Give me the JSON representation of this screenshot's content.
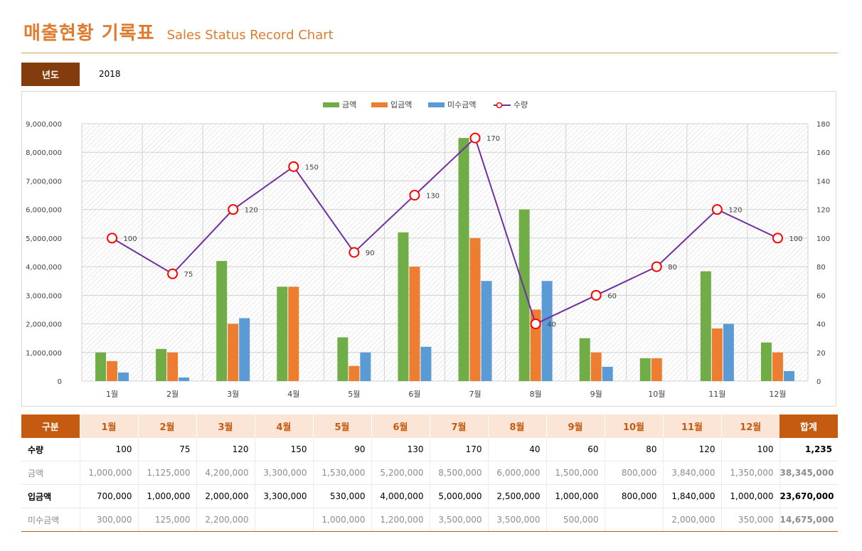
{
  "header": {
    "title": "매출현황 기록표",
    "subtitle": "Sales Status Record Chart"
  },
  "year": {
    "label": "년도",
    "value": "2018"
  },
  "colors": {
    "amount": "#70ad47",
    "received": "#ed7d31",
    "unpaid": "#5b9bd5",
    "quantity_line": "#7030a0",
    "quantity_marker": "#ff0000",
    "accent": "#c55a11"
  },
  "chart_data": {
    "type": "bar",
    "categories": [
      "1월",
      "2월",
      "3월",
      "4월",
      "5월",
      "6월",
      "7월",
      "8월",
      "9월",
      "10월",
      "11월",
      "12월"
    ],
    "series": [
      {
        "name": "금액",
        "type": "bar",
        "axis": "left",
        "values": [
          1000000,
          1125000,
          4200000,
          3300000,
          1530000,
          5200000,
          8500000,
          6000000,
          1500000,
          800000,
          3840000,
          1350000
        ]
      },
      {
        "name": "입금액",
        "type": "bar",
        "axis": "left",
        "values": [
          700000,
          1000000,
          2000000,
          3300000,
          530000,
          4000000,
          5000000,
          2500000,
          1000000,
          800000,
          1840000,
          1000000
        ]
      },
      {
        "name": "미수금액",
        "type": "bar",
        "axis": "left",
        "values": [
          300000,
          125000,
          2200000,
          0,
          1000000,
          1200000,
          3500000,
          3500000,
          500000,
          0,
          2000000,
          350000
        ]
      },
      {
        "name": "수량",
        "type": "line",
        "axis": "right",
        "values": [
          100,
          75,
          120,
          150,
          90,
          130,
          170,
          40,
          60,
          80,
          120,
          100
        ]
      }
    ],
    "y_left": {
      "range": [
        0,
        9000000
      ],
      "ticks": [
        "0",
        "1,000,000",
        "2,000,000",
        "3,000,000",
        "4,000,000",
        "5,000,000",
        "6,000,000",
        "7,000,000",
        "8,000,000",
        "9,000,000"
      ]
    },
    "y_right": {
      "range": [
        0,
        180
      ],
      "ticks": [
        "0",
        "20",
        "40",
        "60",
        "80",
        "100",
        "120",
        "140",
        "160",
        "180"
      ]
    },
    "legend_position": "top-center",
    "grid": true
  },
  "table": {
    "corner": "구분",
    "months": [
      "1월",
      "2월",
      "3월",
      "4월",
      "5월",
      "6월",
      "7월",
      "8월",
      "9월",
      "10월",
      "11월",
      "12월"
    ],
    "total_header": "합계",
    "rows": [
      {
        "label": "수량",
        "style": "bold",
        "values": [
          "100",
          "75",
          "120",
          "150",
          "90",
          "130",
          "170",
          "40",
          "60",
          "80",
          "120",
          "100"
        ],
        "total": "1,235"
      },
      {
        "label": "금액",
        "style": "gray",
        "values": [
          "1,000,000",
          "1,125,000",
          "4,200,000",
          "3,300,000",
          "1,530,000",
          "5,200,000",
          "8,500,000",
          "6,000,000",
          "1,500,000",
          "800,000",
          "3,840,000",
          "1,350,000"
        ],
        "total": "38,345,000"
      },
      {
        "label": "입금액",
        "style": "bold",
        "values": [
          "700,000",
          "1,000,000",
          "2,000,000",
          "3,300,000",
          "530,000",
          "4,000,000",
          "5,000,000",
          "2,500,000",
          "1,000,000",
          "800,000",
          "1,840,000",
          "1,000,000"
        ],
        "total": "23,670,000"
      },
      {
        "label": "미수금액",
        "style": "gray",
        "values": [
          "300,000",
          "125,000",
          "2,200,000",
          "",
          "1,000,000",
          "1,200,000",
          "3,500,000",
          "3,500,000",
          "500,000",
          "",
          "2,000,000",
          "350,000"
        ],
        "total": "14,675,000"
      }
    ]
  }
}
